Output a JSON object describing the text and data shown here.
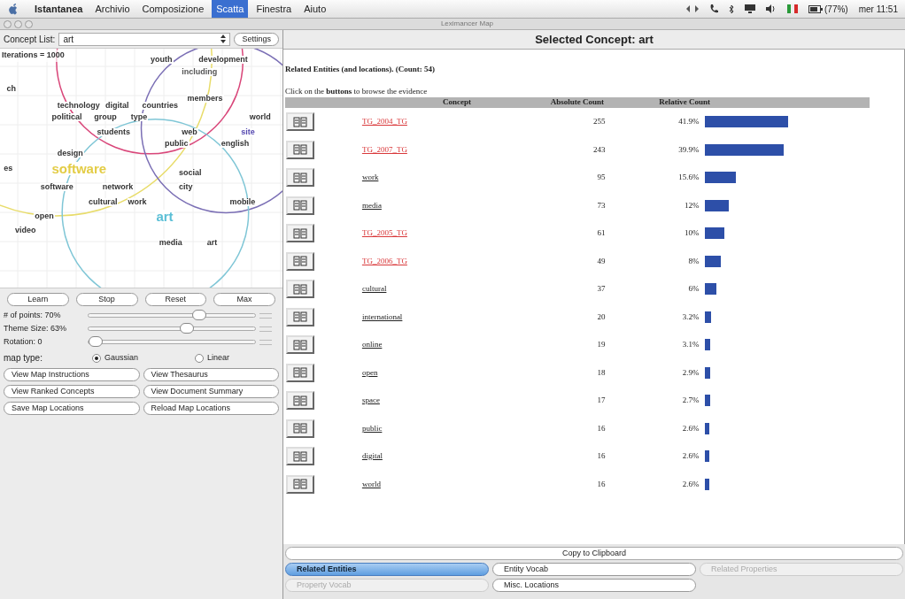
{
  "menu_bar": {
    "app": "Istantanea",
    "items": [
      {
        "label": "Archivio",
        "selected": false
      },
      {
        "label": "Composizione",
        "selected": false
      },
      {
        "label": "Scatta",
        "selected": true
      },
      {
        "label": "Finestra",
        "selected": false
      },
      {
        "label": "Aiuto",
        "selected": false
      }
    ],
    "battery": "(77%)",
    "clock": "mer 11:51"
  },
  "window": {
    "title": "Leximancer Map"
  },
  "left_panel": {
    "concept_list": {
      "label": "Concept List:",
      "value": "art"
    },
    "settings_button": "Settings",
    "map": {
      "iterations": "Iterations = 1000",
      "themes": [
        {
          "color": "#e8dc6a"
        },
        {
          "color": "#d9477a"
        },
        {
          "color": "#7b6fb5"
        },
        {
          "color": "#7fc6d6"
        }
      ],
      "concepts": [
        {
          "label": "youth",
          "color": "#333333",
          "big": false
        },
        {
          "label": "development",
          "color": "#333333",
          "big": false
        },
        {
          "label": "including",
          "color": "#555555",
          "big": false
        },
        {
          "label": "ch",
          "color": "#333333",
          "big": false
        },
        {
          "label": "members",
          "color": "#333333",
          "big": false
        },
        {
          "label": "technology",
          "color": "#333333",
          "big": false
        },
        {
          "label": "digital",
          "color": "#333333",
          "big": false
        },
        {
          "label": "countries",
          "color": "#333333",
          "big": false
        },
        {
          "label": "political",
          "color": "#333333",
          "big": false
        },
        {
          "label": "group",
          "color": "#333333",
          "big": false
        },
        {
          "label": "type",
          "color": "#333333",
          "big": false
        },
        {
          "label": "world",
          "color": "#333333",
          "big": false
        },
        {
          "label": "students",
          "color": "#333333",
          "big": false
        },
        {
          "label": "web",
          "color": "#333333",
          "big": false
        },
        {
          "label": "site",
          "color": "#5548b0",
          "big": false
        },
        {
          "label": "public",
          "color": "#333333",
          "big": false
        },
        {
          "label": "english",
          "color": "#333333",
          "big": false
        },
        {
          "label": "design",
          "color": "#333333",
          "big": false
        },
        {
          "label": "es",
          "color": "#333333",
          "big": false
        },
        {
          "label": "software",
          "color": "#e3cc45",
          "big": true
        },
        {
          "label": "social",
          "color": "#333333",
          "big": false
        },
        {
          "label": "software",
          "color": "#333333",
          "big": false
        },
        {
          "label": "network",
          "color": "#333333",
          "big": false
        },
        {
          "label": "city",
          "color": "#333333",
          "big": false
        },
        {
          "label": "cultural",
          "color": "#333333",
          "big": false
        },
        {
          "label": "work",
          "color": "#333333",
          "big": false
        },
        {
          "label": "mobile",
          "color": "#333333",
          "big": false
        },
        {
          "label": "open",
          "color": "#333333",
          "big": false
        },
        {
          "label": "art",
          "color": "#5bbfd6",
          "big": true
        },
        {
          "label": "video",
          "color": "#333333",
          "big": false
        },
        {
          "label": "media",
          "color": "#333333",
          "big": false
        },
        {
          "label": "art",
          "color": "#333333",
          "big": false
        }
      ]
    },
    "map_buttons": [
      "Learn",
      "Stop",
      "Reset",
      "Max"
    ],
    "sliders": [
      {
        "label": "# of points: 70%",
        "level": 0.68
      },
      {
        "label": "Theme Size: 63%",
        "level": 0.6
      },
      {
        "label": "Rotation: 0",
        "level": 0.0
      }
    ],
    "map_type": {
      "label": "map type:",
      "options": [
        {
          "label": "Gaussian",
          "selected": true
        },
        {
          "label": "Linear",
          "selected": false
        }
      ]
    },
    "actions": [
      "View Map Instructions",
      "View Thesaurus",
      "View Ranked Concepts",
      "View Document Summary",
      "Save Map Locations",
      "Reload Map Locations"
    ]
  },
  "right_panel": {
    "title": "Selected Concept: art",
    "heading": "Related Entities (and locations). (Count: 54)",
    "hint": "Click on the **buttons** to browse the evidence",
    "table": {
      "columns": [
        "Concept",
        "Absolute Count",
        "Relative Count"
      ],
      "rows": [
        {
          "concept": "TG_2004_TG",
          "kind": "tag",
          "count": "255",
          "percent": "41.9%"
        },
        {
          "concept": "TG_2007_TG",
          "kind": "tag",
          "count": "243",
          "percent": "39.9%"
        },
        {
          "concept": "work",
          "kind": "word",
          "count": "95",
          "percent": "15.6%"
        },
        {
          "concept": "media",
          "kind": "word",
          "count": "73",
          "percent": "12%"
        },
        {
          "concept": "TG_2005_TG",
          "kind": "tag",
          "count": "61",
          "percent": "10%"
        },
        {
          "concept": "TG_2006_TG",
          "kind": "tag",
          "count": "49",
          "percent": "8%"
        },
        {
          "concept": "cultural",
          "kind": "word",
          "count": "37",
          "percent": "6%"
        },
        {
          "concept": "international",
          "kind": "word",
          "count": "20",
          "percent": "3.2%"
        },
        {
          "concept": "online",
          "kind": "word",
          "count": "19",
          "percent": "3.1%"
        },
        {
          "concept": "open",
          "kind": "word",
          "count": "18",
          "percent": "2.9%"
        },
        {
          "concept": "space",
          "kind": "word",
          "count": "17",
          "percent": "2.7%"
        },
        {
          "concept": "public",
          "kind": "word",
          "count": "16",
          "percent": "2.6%"
        },
        {
          "concept": "digital",
          "kind": "word",
          "count": "16",
          "percent": "2.6%"
        },
        {
          "concept": "world",
          "kind": "word",
          "count": "16",
          "percent": "2.6%"
        }
      ]
    },
    "copy_button": "Copy to Clipboard",
    "tabs": [
      {
        "label": "Related Entities",
        "selected": true,
        "disabled": false
      },
      {
        "label": "Entity Vocab",
        "selected": false,
        "disabled": false
      },
      {
        "label": "Related Properties",
        "selected": false,
        "disabled": true
      },
      {
        "label": "Property Vocab",
        "selected": false,
        "disabled": true
      },
      {
        "label": "Misc. Locations",
        "selected": false,
        "disabled": false
      }
    ]
  }
}
